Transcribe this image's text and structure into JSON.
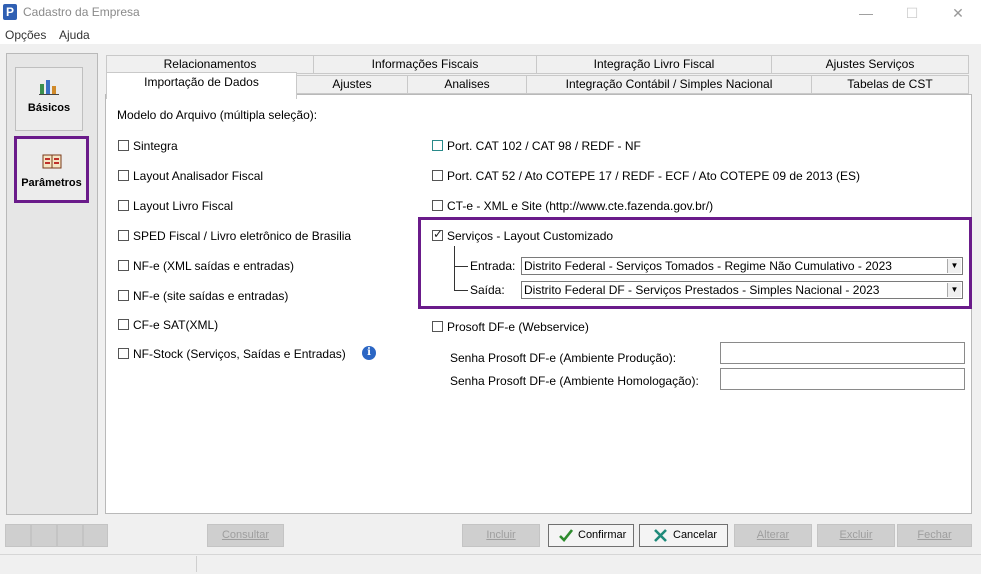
{
  "window": {
    "title": "Cadastro da Empresa",
    "app_icon_letter": "P",
    "minimize_glyph": "—",
    "maximize_glyph": "☐",
    "close_glyph": "✕"
  },
  "menu": {
    "items": [
      "Opções",
      "Ajuda"
    ]
  },
  "sidebar": {
    "basicos_label": "Básicos",
    "parametros_label": "Parâmetros"
  },
  "tabs": {
    "row1": [
      "Relacionamentos",
      "Informações Fiscais",
      "Integração Livro Fiscal",
      "Ajustes Serviços"
    ],
    "row2": [
      "Importação de Dados",
      "Ajustes",
      "Analises",
      "Integração Contábil / Simples Nacional",
      "Tabelas de CST"
    ],
    "active": "Importação de Dados"
  },
  "content": {
    "section_title": "Modelo do Arquivo (múltipla seleção):",
    "left_options": [
      {
        "label": "Sintegra",
        "checked": false
      },
      {
        "label": "Layout Analisador Fiscal",
        "checked": false
      },
      {
        "label": "Layout Livro Fiscal",
        "checked": false
      },
      {
        "label": "SPED Fiscal / Livro eletrônico de Brasilia",
        "checked": false
      },
      {
        "label": "NF-e (XML saídas e entradas)",
        "checked": false
      },
      {
        "label": "NF-e (site saídas e entradas)",
        "checked": false
      },
      {
        "label": "CF-e SAT(XML)",
        "checked": false
      },
      {
        "label": "NF-Stock (Serviços, Saídas e Entradas)",
        "checked": false
      }
    ],
    "info_icon_glyph": "i",
    "right_options": [
      {
        "label": "Port. CAT 102 / CAT 98 / REDF - NF",
        "checked": false
      },
      {
        "label": "Port. CAT 52 / Ato COTEPE 17 / REDF - ECF / Ato COTEPE 09 de 2013 (ES)",
        "checked": false
      },
      {
        "label": "CT-e - XML e Site (http://www.cte.fazenda.gov.br/)",
        "checked": false
      }
    ],
    "servicos": {
      "label": "Serviços - Layout Customizado",
      "checked": true,
      "entrada_label": "Entrada:",
      "entrada_value": "Distrito Federal - Serviços Tomados - Regime Não Cumulativo - 2023",
      "saida_label": "Saída:",
      "saida_value": "Distrito Federal DF - Serviços Prestados - Simples Nacional - 2023"
    },
    "prosoft": {
      "label": "Prosoft DF-e (Webservice)",
      "checked": false,
      "senha_producao_label": "Senha Prosoft DF-e (Ambiente Produção):",
      "senha_producao_value": "",
      "senha_homologacao_label": "Senha Prosoft DF-e (Ambiente Homologação):",
      "senha_homologacao_value": ""
    }
  },
  "buttons": {
    "consultar": "Consultar",
    "incluir": "Incluir",
    "confirmar": "Confirmar",
    "cancelar": "Cancelar",
    "alterar": "Alterar",
    "excluir": "Excluir",
    "fechar": "Fechar"
  },
  "icons": {
    "confirm_icon": "check-icon",
    "cancel_icon": "x-icon"
  },
  "colors": {
    "highlight": "#6a1b8a",
    "check_green": "#2e8b2e",
    "cancel_teal": "#1f8a7a"
  }
}
